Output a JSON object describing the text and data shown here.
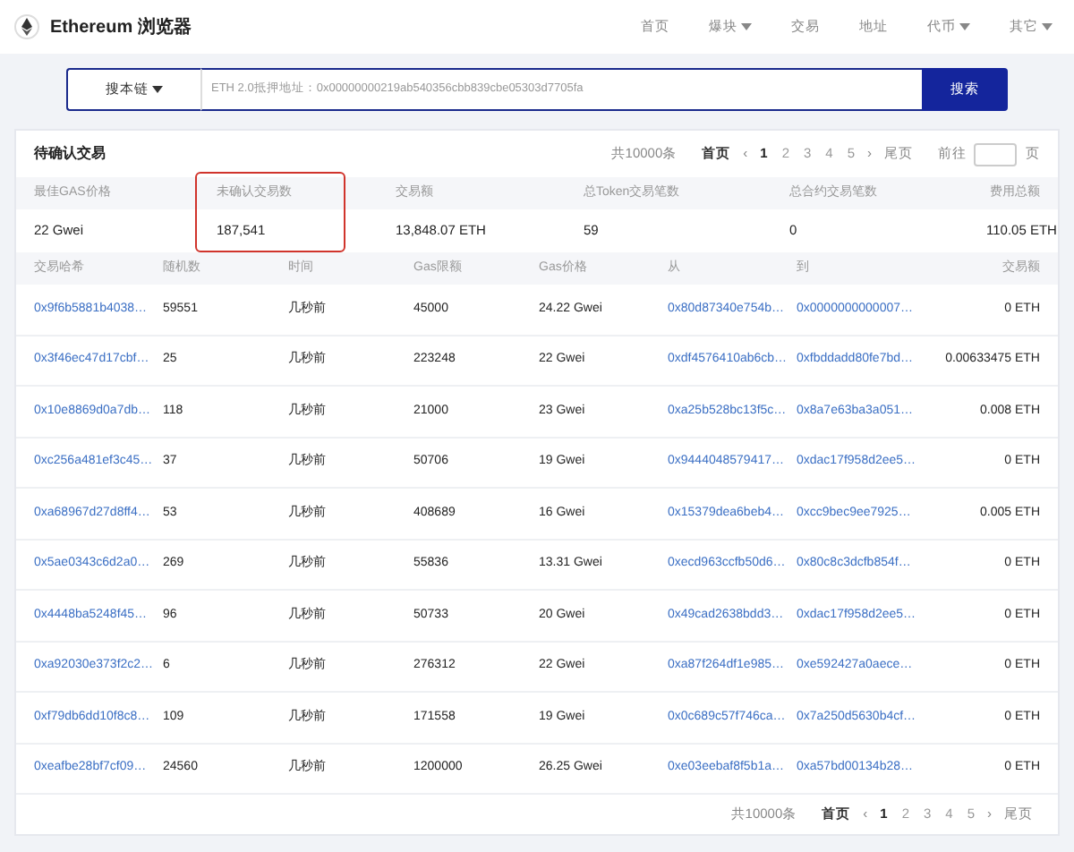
{
  "header": {
    "brand": "Ethereum 浏览器",
    "nav": [
      {
        "label": "首页",
        "dropdown": false
      },
      {
        "label": "爆块",
        "dropdown": true
      },
      {
        "label": "交易",
        "dropdown": false
      },
      {
        "label": "地址",
        "dropdown": false
      },
      {
        "label": "代币",
        "dropdown": true
      },
      {
        "label": "其它",
        "dropdown": true
      }
    ]
  },
  "search": {
    "scope": "搜本链",
    "placeholder": "ETH 2.0抵押地址：0x00000000219ab540356cbb839cbe05303d7705fa",
    "button": "搜索"
  },
  "panel": {
    "title": "待确认交易",
    "pager_top": {
      "total": "共10000条",
      "first": "首页",
      "pages": [
        {
          "label": "1",
          "selected": true
        },
        {
          "label": "2",
          "selected": false
        },
        {
          "label": "3",
          "selected": false
        },
        {
          "label": "4",
          "selected": false
        },
        {
          "label": "5",
          "selected": false
        }
      ],
      "prev": "‹",
      "next": "›",
      "last": "尾页",
      "goto": "前往",
      "goto_suffix": "页"
    },
    "stats": [
      {
        "label": "最佳GAS价格",
        "value": "22 Gwei",
        "highlighted": false
      },
      {
        "label": "未确认交易数",
        "value": "187,541",
        "highlighted": true
      },
      {
        "label": "交易额",
        "value": "13,848.07 ETH",
        "highlighted": false
      },
      {
        "label": "总Token交易笔数",
        "value": "59",
        "highlighted": false
      },
      {
        "label": "总合约交易笔数",
        "value": "0",
        "highlighted": false
      },
      {
        "label": "费用总额",
        "value": "110.05 ETH",
        "highlighted": false
      }
    ],
    "table": {
      "columns": [
        "交易哈希",
        "随机数",
        "时间",
        "Gas限额",
        "Gas价格",
        "从",
        "到",
        "交易额"
      ],
      "rows": [
        [
          "0x9f6b5881b4038…",
          "59551",
          "几秒前",
          "45000",
          "24.22 Gwei",
          "0x80d87340e754b…",
          "0x0000000000007…",
          "0 ETH"
        ],
        [
          "0x3f46ec47d17cbf…",
          "25",
          "几秒前",
          "223248",
          "22 Gwei",
          "0xdf4576410ab6cb…",
          "0xfbddadd80fe7bd…",
          "0.00633475 ETH"
        ],
        [
          "0x10e8869d0a7db…",
          "118",
          "几秒前",
          "21000",
          "23 Gwei",
          "0xa25b528bc13f5c…",
          "0x8a7e63ba3a051…",
          "0.008 ETH"
        ],
        [
          "0xc256a481ef3c45…",
          "37",
          "几秒前",
          "50706",
          "19 Gwei",
          "0x9444048579417…",
          "0xdac17f958d2ee5…",
          "0 ETH"
        ],
        [
          "0xa68967d27d8ff4…",
          "53",
          "几秒前",
          "408689",
          "16 Gwei",
          "0x15379dea6beb4…",
          "0xcc9bec9ee7925…",
          "0.005 ETH"
        ],
        [
          "0x5ae0343c6d2a0…",
          "269",
          "几秒前",
          "55836",
          "13.31 Gwei",
          "0xecd963ccfb50d6…",
          "0x80c8c3dcfb854f…",
          "0 ETH"
        ],
        [
          "0x4448ba5248f45…",
          "96",
          "几秒前",
          "50733",
          "20 Gwei",
          "0x49cad2638bdd3…",
          "0xdac17f958d2ee5…",
          "0 ETH"
        ],
        [
          "0xa92030e373f2c2…",
          "6",
          "几秒前",
          "276312",
          "22 Gwei",
          "0xa87f264df1e985…",
          "0xe592427a0aece…",
          "0 ETH"
        ],
        [
          "0xf79db6dd10f8c8…",
          "109",
          "几秒前",
          "171558",
          "19 Gwei",
          "0x0c689c57f746ca…",
          "0x7a250d5630b4cf…",
          "0 ETH"
        ],
        [
          "0xeafbe28bf7cf09…",
          "24560",
          "几秒前",
          "1200000",
          "26.25 Gwei",
          "0xe03eebaf8f5b1a…",
          "0xa57bd00134b28…",
          "0 ETH"
        ]
      ]
    },
    "pager_bottom": {
      "total": "共10000条",
      "first": "首页",
      "pages": [
        {
          "label": "1",
          "selected": true
        },
        {
          "label": "2",
          "selected": false
        },
        {
          "label": "3",
          "selected": false
        },
        {
          "label": "4",
          "selected": false
        },
        {
          "label": "5",
          "selected": false
        }
      ],
      "prev": "‹",
      "next": "›",
      "last": "尾页"
    }
  }
}
